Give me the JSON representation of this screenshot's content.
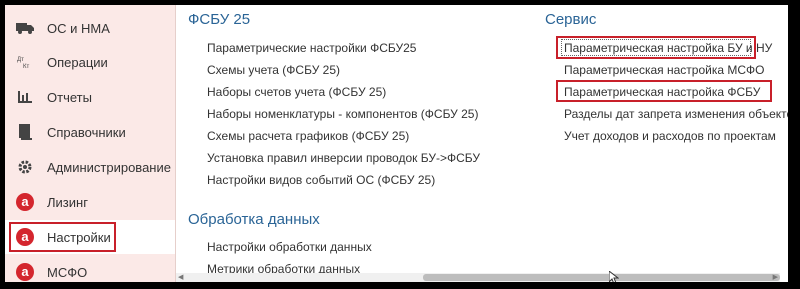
{
  "sidebar": {
    "items": [
      {
        "label": "ОС и НМА",
        "icon": "truck-icon"
      },
      {
        "label": "Операции",
        "icon": "debit-credit-icon"
      },
      {
        "label": "Отчеты",
        "icon": "bar-chart-icon"
      },
      {
        "label": "Справочники",
        "icon": "book-icon"
      },
      {
        "label": "Администрирование",
        "icon": "gear-icon"
      },
      {
        "label": "Лизинг",
        "icon": "a-logo-icon"
      },
      {
        "label": "Настройки",
        "icon": "a-logo-icon"
      },
      {
        "label": "МСФО",
        "icon": "a-logo-icon"
      }
    ],
    "active_index": 6
  },
  "main": {
    "fsbu": {
      "title": "ФСБУ 25",
      "links": [
        "Параметрические настройки ФСБУ25",
        "Схемы учета (ФСБУ 25)",
        "Наборы счетов учета (ФСБУ 25)",
        "Наборы номенклатуры - компонентов (ФСБУ 25)",
        "Схемы расчета графиков (ФСБУ 25)",
        "Установка правил инверсии проводок БУ->ФСБУ",
        "Настройки видов событий ОС (ФСБУ 25)"
      ]
    },
    "processing": {
      "title": "Обработка данных",
      "links": [
        "Настройки обработки данных",
        "Метрики обработки данных"
      ]
    },
    "service": {
      "title": "Сервис",
      "links": [
        "Параметрическая настройка БУ и НУ",
        "Параметрическая настройка МСФО",
        "Параметрическая настройка ФСБУ",
        "Разделы дат запрета изменения объектов",
        "Учет доходов и расходов по проектам"
      ]
    }
  },
  "colors": {
    "sidebar_bg": "#fbe9e7",
    "section_title": "#2a6496",
    "highlight": "#c8202a",
    "logo_red": "#d4262e"
  }
}
